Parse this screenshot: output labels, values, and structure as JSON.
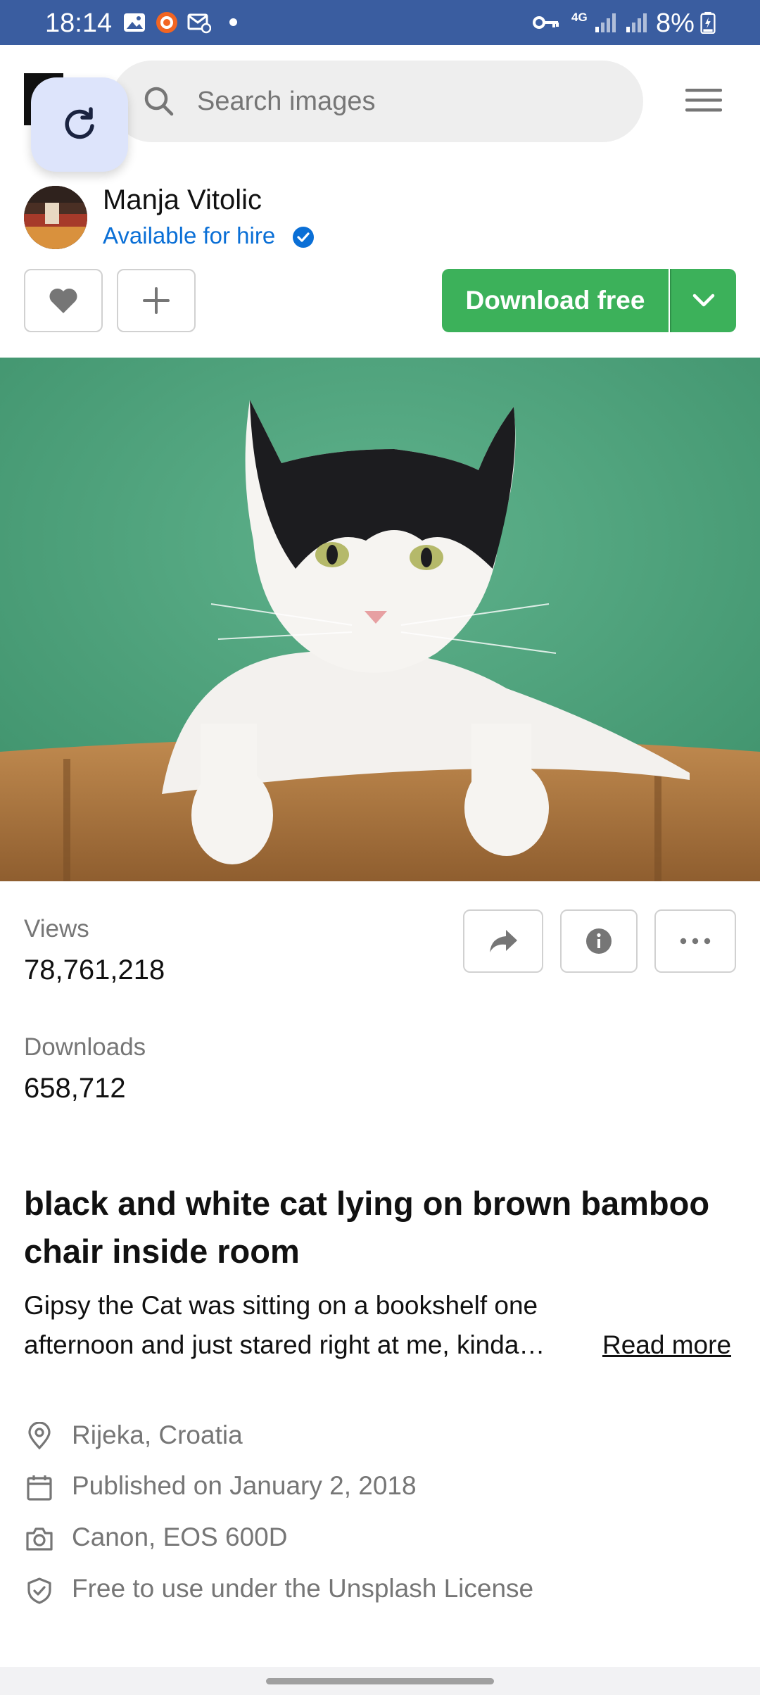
{
  "status_bar": {
    "time": "18:14",
    "battery_text": "8%",
    "network_label": "4G",
    "icons": [
      "gallery-icon",
      "recorder-icon",
      "mail-settings-icon",
      "vpn-key-icon",
      "signal-icon",
      "battery-icon"
    ]
  },
  "search": {
    "placeholder": "Search images"
  },
  "author": {
    "name": "Manja Vitolic",
    "hire_text": "Available for hire"
  },
  "actions": {
    "download_label": "Download free"
  },
  "stats": {
    "views_label": "Views",
    "views_value": "78,761,218",
    "downloads_label": "Downloads",
    "downloads_value": "658,712"
  },
  "photo": {
    "title_line1": "black and white cat lying on brown bamboo",
    "title_line2": "chair inside room",
    "description_line1": "Gipsy the Cat was sitting on a bookshelf one",
    "description_line2": "afternoon and just stared right at me, kinda…",
    "read_more": "Read more"
  },
  "meta": {
    "location": "Rijeka, Croatia",
    "published": "Published on January 2, 2018",
    "camera": "Canon, EOS 600D",
    "license": "Free to use under the Unsplash License"
  },
  "colors": {
    "status_bar": "#3a5da0",
    "download_green": "#3cb15a",
    "hire_blue": "#0a6fd6",
    "fab_background": "#dde4fb",
    "muted_text": "#767676"
  }
}
